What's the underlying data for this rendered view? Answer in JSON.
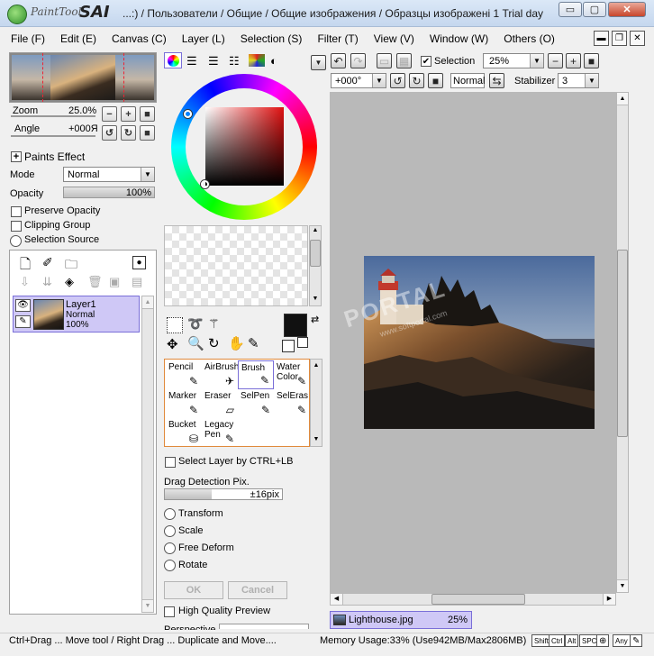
{
  "window": {
    "logo_text": "PaintTool",
    "logo_sai": "SAI",
    "title": "...:) / Пользователи / Общие / Общие изображения / Образцы изображені 1 Trial day",
    "min_glyph": "▭",
    "max_glyph": "▢",
    "close_glyph": "✕"
  },
  "menu": [
    "File (F)",
    "Edit (E)",
    "Canvas (C)",
    "Layer (L)",
    "Selection (S)",
    "Filter (T)",
    "View (V)",
    "Window (W)",
    "Others (O)"
  ],
  "navigator": {
    "zoom_label": "Zoom",
    "zoom_value": "25.0%",
    "angle_label": "Angle",
    "angle_value": "+000Я"
  },
  "layer_panel": {
    "paints_effect": "Paints Effect",
    "mode_label": "Mode",
    "mode_value": "Normal",
    "opacity_label": "Opacity",
    "opacity_value": "100%",
    "opacity_fill": 1.0,
    "preserve_opacity": "Preserve Opacity",
    "clipping_group": "Clipping Group",
    "selection_source": "Selection Source",
    "layers": [
      {
        "name": "Layer1",
        "mode": "Normal",
        "opacity": "100%"
      }
    ]
  },
  "tools": [
    {
      "label": "Pencil",
      "icon": "✎"
    },
    {
      "label": "AirBrush",
      "icon": "✈"
    },
    {
      "label": "Brush",
      "icon": "✎"
    },
    {
      "label": "Water Color",
      "icon": "✎"
    },
    {
      "label": "Marker",
      "icon": "✎"
    },
    {
      "label": "Eraser",
      "icon": "▱"
    },
    {
      "label": "SelPen",
      "icon": "✎"
    },
    {
      "label": "SelEras",
      "icon": "✎"
    },
    {
      "label": "Bucket",
      "icon": "⛁"
    },
    {
      "label": "Legacy Pen",
      "icon": "✎"
    }
  ],
  "tool_options": {
    "select_layer": "Select Layer by CTRL+LB",
    "drag_detection": "Drag Detection Pix.",
    "drag_value": "±16pix",
    "drag_fill": 0.4,
    "transform": "Transform",
    "scale": "Scale",
    "free_deform": "Free Deform",
    "rotate": "Rotate",
    "ok": "OK",
    "cancel": "Cancel",
    "high_quality": "High Quality Preview",
    "perspective": "Perspective"
  },
  "canvas_toolbar": {
    "selection_label": "Selection",
    "zoom_value": "25%",
    "angle_value": "+000°",
    "mode_value": "Normal",
    "stabilizer_label": "Stabilizer",
    "stabilizer_value": "3"
  },
  "document_tab": {
    "name": "Lighthouse.jpg",
    "zoom": "25%"
  },
  "watermark": "PORTAL",
  "watermark_url": "www.softportal.com",
  "status": {
    "hint": "Ctrl+Drag ... Move tool / Right Drag ... Duplicate and Move....",
    "memory": "Memory Usage:33% (Use942MB/Max2806MB)",
    "keys": [
      "Shift",
      "Ctrl",
      "Alt",
      "SPC",
      "Any"
    ]
  },
  "colors": {
    "accent_purple": "#7a6fd8",
    "layer_selected_bg": "#cfc8f6",
    "doc_tab_bg": "#cfc8f6",
    "canvas_bg": "#b9b9b9"
  }
}
